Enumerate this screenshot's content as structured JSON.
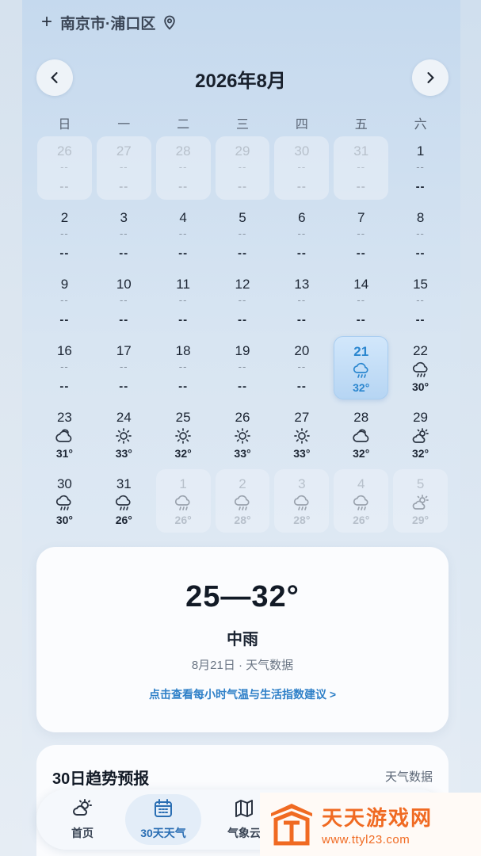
{
  "location": {
    "plus": "+",
    "name": "南京市·浦口区"
  },
  "calendar": {
    "title": "2026年8月",
    "weekdays": [
      "日",
      "一",
      "二",
      "三",
      "四",
      "五",
      "六"
    ],
    "cells": [
      {
        "day": "26",
        "out": true,
        "icon": null,
        "temp": null
      },
      {
        "day": "27",
        "out": true,
        "icon": null,
        "temp": null
      },
      {
        "day": "28",
        "out": true,
        "icon": null,
        "temp": null
      },
      {
        "day": "29",
        "out": true,
        "icon": null,
        "temp": null
      },
      {
        "day": "30",
        "out": true,
        "icon": null,
        "temp": null
      },
      {
        "day": "31",
        "out": true,
        "icon": null,
        "temp": null
      },
      {
        "day": "1",
        "out": false,
        "icon": null,
        "temp": null
      },
      {
        "day": "2",
        "out": false,
        "icon": null,
        "temp": null
      },
      {
        "day": "3",
        "out": false,
        "icon": null,
        "temp": null
      },
      {
        "day": "4",
        "out": false,
        "icon": null,
        "temp": null
      },
      {
        "day": "5",
        "out": false,
        "icon": null,
        "temp": null
      },
      {
        "day": "6",
        "out": false,
        "icon": null,
        "temp": null
      },
      {
        "day": "7",
        "out": false,
        "icon": null,
        "temp": null
      },
      {
        "day": "8",
        "out": false,
        "icon": null,
        "temp": null
      },
      {
        "day": "9",
        "out": false,
        "icon": null,
        "temp": null
      },
      {
        "day": "10",
        "out": false,
        "icon": null,
        "temp": null
      },
      {
        "day": "11",
        "out": false,
        "icon": null,
        "temp": null
      },
      {
        "day": "12",
        "out": false,
        "icon": null,
        "temp": null
      },
      {
        "day": "13",
        "out": false,
        "icon": null,
        "temp": null
      },
      {
        "day": "14",
        "out": false,
        "icon": null,
        "temp": null
      },
      {
        "day": "15",
        "out": false,
        "icon": null,
        "temp": null
      },
      {
        "day": "16",
        "out": false,
        "icon": null,
        "temp": null
      },
      {
        "day": "17",
        "out": false,
        "icon": null,
        "temp": null
      },
      {
        "day": "18",
        "out": false,
        "icon": null,
        "temp": null
      },
      {
        "day": "19",
        "out": false,
        "icon": null,
        "temp": null
      },
      {
        "day": "20",
        "out": false,
        "icon": null,
        "temp": null
      },
      {
        "day": "21",
        "out": false,
        "selected": true,
        "icon": "rain",
        "temp": "32°"
      },
      {
        "day": "22",
        "out": false,
        "icon": "rain",
        "temp": "30°"
      },
      {
        "day": "23",
        "out": false,
        "icon": "cloudy",
        "temp": "31°"
      },
      {
        "day": "24",
        "out": false,
        "icon": "sun",
        "temp": "33°"
      },
      {
        "day": "25",
        "out": false,
        "icon": "sun",
        "temp": "32°"
      },
      {
        "day": "26",
        "out": false,
        "icon": "sun",
        "temp": "33°"
      },
      {
        "day": "27",
        "out": false,
        "icon": "sun",
        "temp": "33°"
      },
      {
        "day": "28",
        "out": false,
        "icon": "cloudy",
        "temp": "32°"
      },
      {
        "day": "29",
        "out": false,
        "icon": "partly-cloudy",
        "temp": "32°"
      },
      {
        "day": "30",
        "out": false,
        "icon": "rain",
        "temp": "30°"
      },
      {
        "day": "31",
        "out": false,
        "icon": "rain",
        "temp": "26°"
      },
      {
        "day": "1",
        "out": true,
        "icon": "rain",
        "temp": "26°"
      },
      {
        "day": "2",
        "out": true,
        "icon": "rain",
        "temp": "28°"
      },
      {
        "day": "3",
        "out": true,
        "icon": "rain",
        "temp": "28°"
      },
      {
        "day": "4",
        "out": true,
        "icon": "rain",
        "temp": "26°"
      },
      {
        "day": "5",
        "out": true,
        "icon": "partly-cloudy",
        "temp": "29°"
      }
    ],
    "placeholder": "--"
  },
  "detail": {
    "range": "25—32°",
    "condition": "中雨",
    "meta": "8月21日 · 天气数据",
    "link": "点击查看每小时气温与生活指数建议 >"
  },
  "trend": {
    "title": "30日趋势预报",
    "source": "天气数据"
  },
  "tabs": [
    {
      "label": "首页",
      "icon": "weather-icon"
    },
    {
      "label": "30天天气",
      "icon": "calendar-icon"
    },
    {
      "label": "气象云",
      "icon": "map-icon"
    }
  ],
  "watermark": {
    "title": "天天游戏网",
    "url": "www.ttyl23.com"
  }
}
